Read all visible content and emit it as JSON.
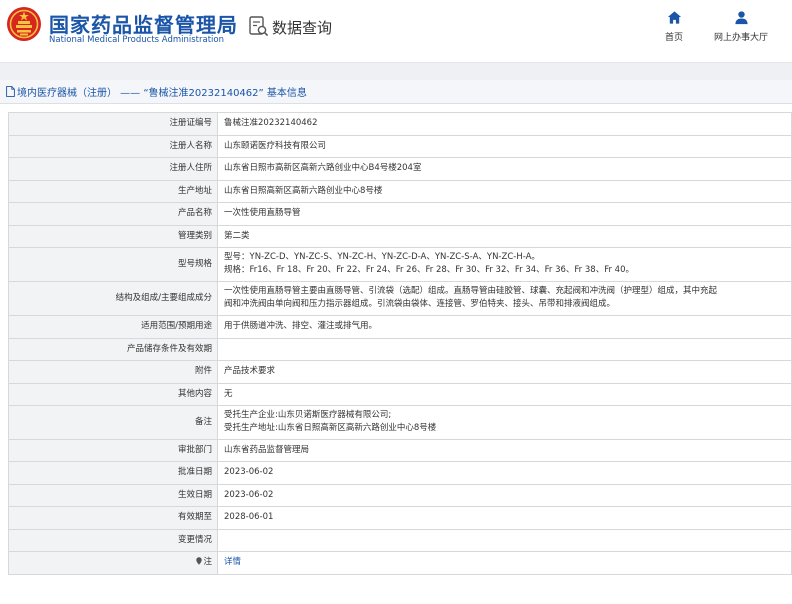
{
  "site": {
    "name_cn": "国家药品监督管理局",
    "name_en": "National Medical Products Administration",
    "search_label": "数据查询",
    "nav": {
      "home": "首页",
      "hall": "网上办事大厅"
    }
  },
  "breadcrumb": "境内医疗器械（注册） —— “鲁械注准20232140462” 基本信息",
  "rows": [
    {
      "key": "注册证编号",
      "lines": [
        "鲁械注准20232140462"
      ]
    },
    {
      "key": "注册人名称",
      "lines": [
        "山东颐诺医疗科技有限公司"
      ]
    },
    {
      "key": "注册人住所",
      "lines": [
        "山东省日照市高新区高新六路创业中心B4号楼204室"
      ]
    },
    {
      "key": "生产地址",
      "lines": [
        "山东省日照高新区高新六路创业中心8号楼"
      ]
    },
    {
      "key": "产品名称",
      "lines": [
        "一次性使用直肠导管"
      ]
    },
    {
      "key": "管理类别",
      "lines": [
        "第二类"
      ]
    },
    {
      "key": "型号规格",
      "lines": [
        "型号：YN-ZC-D、YN-ZC-S、YN-ZC-H、YN-ZC-D-A、YN-ZC-S-A、YN-ZC-H-A。",
        "规格：Fr16、Fr 18、Fr 20、Fr 22、Fr 24、Fr 26、Fr 28、Fr 30、Fr 32、Fr 34、Fr 36、Fr 38、Fr 40。"
      ]
    },
    {
      "key": "结构及组成/主要组成成分",
      "lines": [
        "一次性使用直肠导管主要由直肠导管、引流袋（选配）组成。直肠导管由硅胶管、球囊、充起阀和冲洗阀（护理型）组成，其中充起",
        "阀和冲洗阀由单向阀和压力指示器组成。引流袋由袋体、连接管、罗伯特夹、接头、吊带和排液阀组成。"
      ]
    },
    {
      "key": "适用范围/预期用途",
      "lines": [
        "用于供肠道冲洗、排空、灌注或排气用。"
      ]
    },
    {
      "key": "产品储存条件及有效期",
      "lines": [
        ""
      ]
    },
    {
      "key": "附件",
      "lines": [
        "产品技术要求"
      ]
    },
    {
      "key": "其他内容",
      "lines": [
        "无"
      ]
    },
    {
      "key": "备注",
      "lines": [
        "受托生产企业:山东贝诺斯医疗器械有限公司;",
        "受托生产地址:山东省日照高新区高新六路创业中心8号楼"
      ]
    },
    {
      "key": "审批部门",
      "lines": [
        "山东省药品监督管理局"
      ]
    },
    {
      "key": "批准日期",
      "lines": [
        "2023-06-02"
      ]
    },
    {
      "key": "生效日期",
      "lines": [
        "2023-06-02"
      ]
    },
    {
      "key": "有效期至",
      "lines": [
        "2028-06-01"
      ]
    },
    {
      "key": "变更情况",
      "lines": [
        ""
      ]
    },
    {
      "key": "注",
      "lines": [
        "详情"
      ],
      "link": true,
      "icon": "location-pin-icon"
    }
  ],
  "colors": {
    "brand_blue": "#1a55a8",
    "emblem_red": "#d7261e",
    "emblem_gold": "#f5c242"
  }
}
